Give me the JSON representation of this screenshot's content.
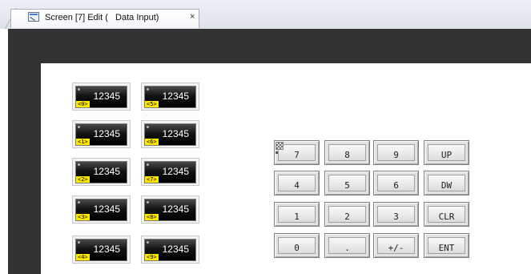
{
  "tab": {
    "title": "Screen [7] Edit (   Data Input)",
    "close_symbol": "×",
    "icon": "screen-edit-icon"
  },
  "colors": {
    "frame": "#333333",
    "canvas": "#ffffff",
    "display_bg": "#000000",
    "display_text": "#ffffff",
    "tag_bg": "#ffe800"
  },
  "displays": [
    {
      "value": "12345",
      "tag": "<0>"
    },
    {
      "value": "12345",
      "tag": "<5>"
    },
    {
      "value": "12345",
      "tag": "<1>"
    },
    {
      "value": "12345",
      "tag": "<6>"
    },
    {
      "value": "12345",
      "tag": "<2>"
    },
    {
      "value": "12345",
      "tag": "<7>"
    },
    {
      "value": "12345",
      "tag": "<3>"
    },
    {
      "value": "12345",
      "tag": "<8>"
    },
    {
      "value": "12345",
      "tag": "<4>"
    },
    {
      "value": "12345",
      "tag": "<9>"
    }
  ],
  "keypad": {
    "keys": [
      "7",
      "8",
      "9",
      "UP",
      "4",
      "5",
      "6",
      "DW",
      "1",
      "2",
      "3",
      "CLR",
      "0",
      ".",
      "+/-",
      "ENT"
    ]
  }
}
